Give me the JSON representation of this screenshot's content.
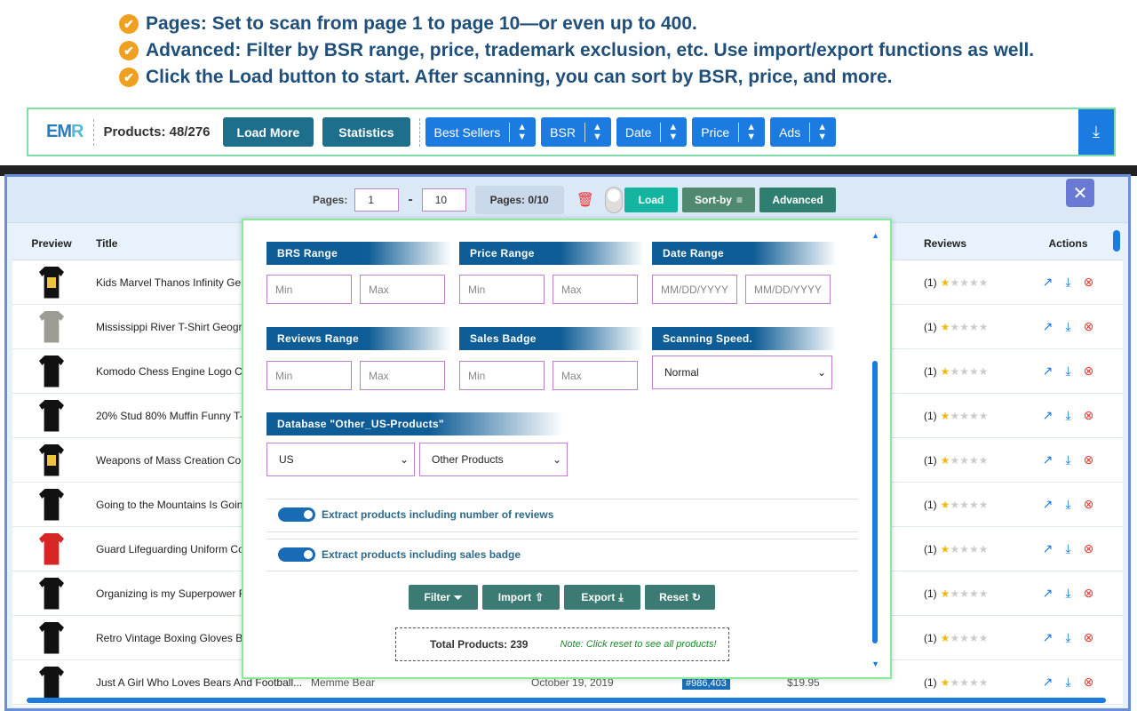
{
  "bullets": [
    "Pages: Set to scan from page 1 to page 10—or even up to 400.",
    "Advanced: Filter by BSR range, price, trademark exclusion, etc. Use import/export functions as well.",
    "Click the Load button to start. After scanning, you can sort by BSR, price, and more."
  ],
  "topbar": {
    "logo_main": "EM",
    "logo_accent": "R",
    "products": "Products: 48/276",
    "load_more": "Load More",
    "statistics": "Statistics",
    "filters": [
      "Best Sellers",
      "BSR",
      "Date",
      "Price",
      "Ads"
    ]
  },
  "panel": {
    "pages_label": "Pages:",
    "page_from": "1",
    "page_to": "10",
    "pages_status": "Pages: 0/10",
    "load": "Load",
    "sort_by": "Sort-by",
    "advanced": "Advanced",
    "close": "✕"
  },
  "table": {
    "headers": {
      "preview": "Preview",
      "title": "Title",
      "reviews": "Reviews",
      "actions": "Actions"
    },
    "rows": [
      {
        "title": "Kids Marvel Thanos Infinity Gen",
        "reviews": "(1)",
        "style": "print"
      },
      {
        "title": "Mississippi River T-Shirt Geogra",
        "reviews": "(1)",
        "style": "grey"
      },
      {
        "title": "Komodo Chess Engine Logo Che",
        "reviews": "(1)",
        "style": "plain"
      },
      {
        "title": "20% Stud 80% Muffin Funny T-",
        "reviews": "(1)",
        "style": "plain"
      },
      {
        "title": "Weapons of Mass Creation Colo",
        "reviews": "(1)",
        "style": "print"
      },
      {
        "title": "Going to the Mountains Is Goin",
        "reviews": "(1)",
        "style": "plain"
      },
      {
        "title": "Guard Lifeguarding Uniform Co",
        "reviews": "(1)",
        "style": "red"
      },
      {
        "title": "Organizing is my Superpower F",
        "reviews": "(1)",
        "style": "plain"
      },
      {
        "title": "Retro Vintage Boxing Gloves Bo",
        "reviews": "(1)",
        "style": "plain"
      },
      {
        "title": "Just A Girl Who Loves Bears And Football...",
        "reviews": "(1)",
        "style": "plain",
        "brand": "Memme Bear",
        "date": "October 19, 2019",
        "bsr": "#986,403",
        "price": "$19.95"
      }
    ]
  },
  "modal": {
    "bsr_range": "BRS Range",
    "price_range": "Price Range",
    "date_range": "Date Range",
    "reviews_range": "Reviews Range",
    "sales_badge": "Sales Badge",
    "scanning_speed": "Scanning Speed.",
    "min": "Min",
    "max": "Max",
    "date_ph": "MM/DD/YYYY",
    "speed_value": "Normal",
    "database": "Database  \"Other_US-Products\"",
    "db_country": "US",
    "db_category": "Other Products",
    "toggle_reviews": "Extract products including number of reviews",
    "toggle_badge": "Extract products including sales badge",
    "filter": "Filter",
    "import": "Import",
    "export": "Export",
    "reset": "Reset",
    "total": "Total Products: 239",
    "note": "Note: Click reset to see all products!"
  }
}
